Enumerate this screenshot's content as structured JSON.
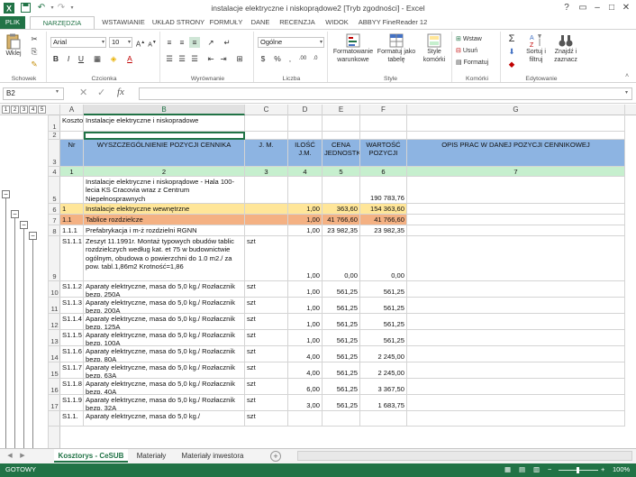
{
  "window": {
    "title": "instalacje elektryczne i niskoprądowe2  [Tryb zgodności] - Excel"
  },
  "ribbon_tabs": [
    "PLIK",
    "NARZĘDZIA GŁÓWNE",
    "WSTAWIANIE",
    "UKŁAD STRONY",
    "FORMUŁY",
    "DANE",
    "RECENZJA",
    "WIDOK",
    "ABBYY FineReader 12"
  ],
  "ribbon": {
    "clipboard": {
      "paste": "Wklej",
      "label": "Schowek"
    },
    "font": {
      "name": "Arial",
      "size": "10",
      "label": "Czcionka"
    },
    "alignment": {
      "label": "Wyrównanie"
    },
    "number": {
      "format": "Ogólne",
      "label": "Liczba"
    },
    "styles": {
      "cond_format": "Formatowanie warunkowe",
      "format_table": "Formatuj jako tabelę",
      "cell_styles": "Style komórki",
      "label": "Style"
    },
    "cells": {
      "insert": "Wstaw",
      "delete": "Usuń",
      "format": "Formatuj",
      "label": "Komórki"
    },
    "editing": {
      "sort": "Sortuj i filtruj",
      "find": "Znajdź i zaznacz",
      "label": "Edytowanie"
    }
  },
  "formula_bar": {
    "name_box": "B2",
    "fx": "fx",
    "value": ""
  },
  "outline_levels": [
    "1",
    "2",
    "3",
    "4",
    "5"
  ],
  "columns": [
    "A",
    "B",
    "C",
    "D",
    "E",
    "F",
    "G"
  ],
  "rows": [
    {
      "num": "1",
      "A": "Kosztorys",
      "B": "Instalacje elektryczne i niskopradowe",
      "C": "",
      "D": "",
      "E": "",
      "F": "",
      "G": ""
    },
    {
      "num": "2",
      "A": "",
      "B": "",
      "C": "",
      "D": "",
      "E": "",
      "F": "",
      "G": ""
    },
    {
      "num": "3",
      "A": "Nr",
      "B": "WYSZCZEGÓLNIENIE POZYCJI CENNIKA",
      "C": "J. M.",
      "D": "ILOŚĆ J.M.",
      "E": "CENA JEDNOSTKOWA",
      "F": "WARTOŚĆ POZYCJI",
      "G": "OPIS PRAC W DANEJ POZYCJI CENNIKOWEJ"
    },
    {
      "num": "4",
      "A": "1",
      "B": "2",
      "C": "3",
      "D": "4",
      "E": "5",
      "F": "6",
      "G": "7"
    },
    {
      "num": "5",
      "A": "",
      "B": "Instalacje elektryczne i niskoprądowe - Hala 100-lecia KS Cracovia wraz z Centrum Niepełnosprawnych",
      "C": "",
      "D": "",
      "E": "",
      "F": "190 783,76",
      "G": ""
    },
    {
      "num": "6",
      "A": "1",
      "B": "Instalacje elektryczne wewnętrzne",
      "C": "",
      "D": "1,00",
      "E": "154 363,60",
      "F": "154 363,60",
      "G": ""
    },
    {
      "num": "7",
      "A": "1.1",
      "B": "Tablice rozdzielcze",
      "C": "",
      "D": "1,00",
      "E": "41 766,60",
      "F": "41 766,60",
      "G": ""
    },
    {
      "num": "8",
      "A": "1.1.1",
      "B": "Prefabrykacja i m-ż rozdzielni RGNN",
      "C": "",
      "D": "1,00",
      "E": "23 982,35",
      "F": "23 982,35",
      "G": ""
    },
    {
      "num": "9",
      "A": "S1.1.1",
      "B": "Zeszyt 11.1991r. Montaż typowych obudów tablic rozdzielczych według kat. et 75 w budownictwie ogólnym, obudowa o powierzchni do 1.0 m2./   za pow. tabl.1,86m2 Krotność=1,86",
      "C": "szt",
      "D": "1,00",
      "E": "0,00",
      "F": "0,00",
      "G": ""
    },
    {
      "num": "10",
      "A": "S1.1.2",
      "B": "Aparaty elektryczne, masa do 5,0 kg./ Rozłacznik bezp. 250A",
      "C": "szt",
      "D": "1,00",
      "E": "561,25",
      "F": "561,25",
      "G": ""
    },
    {
      "num": "11",
      "A": "S1.1.3",
      "B": "Aparaty elektryczne, masa do 5,0 kg./ Rozłacznik bezp. 200A",
      "C": "szt",
      "D": "1,00",
      "E": "561,25",
      "F": "561,25",
      "G": ""
    },
    {
      "num": "12",
      "A": "S1.1.4",
      "B": "Aparaty elektryczne, masa do 5,0 kg./ Rozłacznik bezp. 125A",
      "C": "szt",
      "D": "1,00",
      "E": "561,25",
      "F": "561,25",
      "G": ""
    },
    {
      "num": "13",
      "A": "S1.1.5",
      "B": "Aparaty elektryczne, masa do 5,0 kg./ Rozłacznik bezp. 100A",
      "C": "szt",
      "D": "1,00",
      "E": "561,25",
      "F": "561,25",
      "G": ""
    },
    {
      "num": "14",
      "A": "S1.1.6",
      "B": "Aparaty elektryczne, masa do 5,0 kg./ Rozłacznik bezp. 80A",
      "C": "szt",
      "D": "4,00",
      "E": "561,25",
      "F": "2 245,00",
      "G": ""
    },
    {
      "num": "15",
      "A": "S1.1.7",
      "B": "Aparaty elektryczne, masa do 5,0 kg./ Rozłacznik bezp. 63A",
      "C": "szt",
      "D": "4,00",
      "E": "561,25",
      "F": "2 245,00",
      "G": ""
    },
    {
      "num": "16",
      "A": "S1.1.8",
      "B": "Aparaty elektryczne, masa do 5,0 kg./ Rozłacznik bezp. 40A",
      "C": "szt",
      "D": "6,00",
      "E": "561,25",
      "F": "3 367,50",
      "G": ""
    },
    {
      "num": "17",
      "A": "S1.1.9",
      "B": "Aparaty elektryczne, masa do 5,0 kg./ Rozłacznik bezp. 32A",
      "C": "szt",
      "D": "3,00",
      "E": "561,25",
      "F": "1 683,75",
      "G": ""
    },
    {
      "num": "",
      "A": "S1.1.",
      "B": "Aparaty elektryczne, masa do 5,0 kg./",
      "C": "szt",
      "D": "",
      "E": "",
      "F": "",
      "G": ""
    }
  ],
  "sheets": [
    "Kosztorys - CeSUB",
    "Materiały",
    "Materiały inwestora"
  ],
  "status": {
    "ready": "GOTOWY",
    "zoom": "100%"
  },
  "colors": {
    "accent": "#217346",
    "header_fill": "#8db4e2",
    "number_fill": "#c6efce",
    "level1_fill": "#ffe699",
    "level2_fill": "#f4b183"
  }
}
